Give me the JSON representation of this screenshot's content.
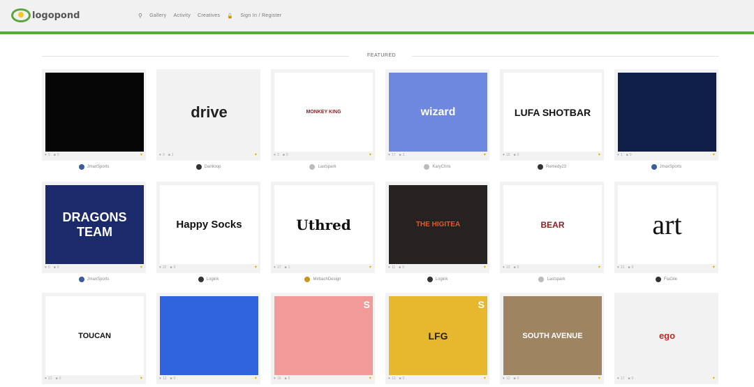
{
  "brand": {
    "name": "logopond"
  },
  "nav": {
    "gallery": "Gallery",
    "activity": "Activity",
    "creatives": "Creatives",
    "auth": "Sign In / Register"
  },
  "featured_label": "FEATURED",
  "cards": [
    {
      "likes": "5",
      "comments": "0",
      "author": "JmaxSports",
      "art": "",
      "bg": "#050505"
    },
    {
      "likes": "9",
      "comments": "1",
      "author": "Daniloop",
      "art": "drive",
      "bg": "#f2f2f2"
    },
    {
      "likes": "3",
      "comments": "0",
      "author": "Lastspark",
      "art": "MONKEY KING",
      "bg": "#ffffff"
    },
    {
      "likes": "17",
      "comments": "3",
      "author": "KaryChris",
      "art": "wizard",
      "bg": "#6d88de"
    },
    {
      "likes": "15",
      "comments": "0",
      "author": "Remedy23",
      "art": "LUFA SHOTBAR",
      "bg": "#ffffff"
    },
    {
      "likes": "1",
      "comments": "0",
      "author": "JmaxSports",
      "art": "",
      "bg": "#0f1e49"
    },
    {
      "likes": "5",
      "comments": "0",
      "author": "JmaxSports",
      "art": "DRAGONS TEAM",
      "bg": "#1a2a6b"
    },
    {
      "likes": "22",
      "comments": "0",
      "author": "Logink",
      "art": "Happy Socks",
      "bg": "#ffffff"
    },
    {
      "likes": "17",
      "comments": "1",
      "author": "MirbachDesign",
      "art": "Uthred",
      "bg": "#ffffff"
    },
    {
      "likes": "11",
      "comments": "0",
      "author": "Logink",
      "art": "THE HIGITEA",
      "bg": "#262221"
    },
    {
      "likes": "13",
      "comments": "0",
      "author": "Lastspark",
      "art": "BEAR",
      "bg": "#ffffff"
    },
    {
      "likes": "21",
      "comments": "0",
      "author": "FiaGile",
      "art": "art",
      "bg": "#ffffff"
    },
    {
      "likes": "21",
      "comments": "0",
      "author": "",
      "art": "TOUCAN",
      "bg": "#ffffff"
    },
    {
      "likes": "12",
      "comments": "0",
      "author": "",
      "art": "",
      "bg": "#2f64de"
    },
    {
      "likes": "16",
      "comments": "6",
      "author": "",
      "art": "",
      "bg": "#f29a9a"
    },
    {
      "likes": "13",
      "comments": "0",
      "author": "",
      "art": "LFG",
      "bg": "#e7b82e"
    },
    {
      "likes": "12",
      "comments": "0",
      "author": "",
      "art": "SOUTH AVENUE",
      "bg": "#9f8461"
    },
    {
      "likes": "17",
      "comments": "0",
      "author": "",
      "art": "ego",
      "bg": "#f2f2f2"
    }
  ]
}
